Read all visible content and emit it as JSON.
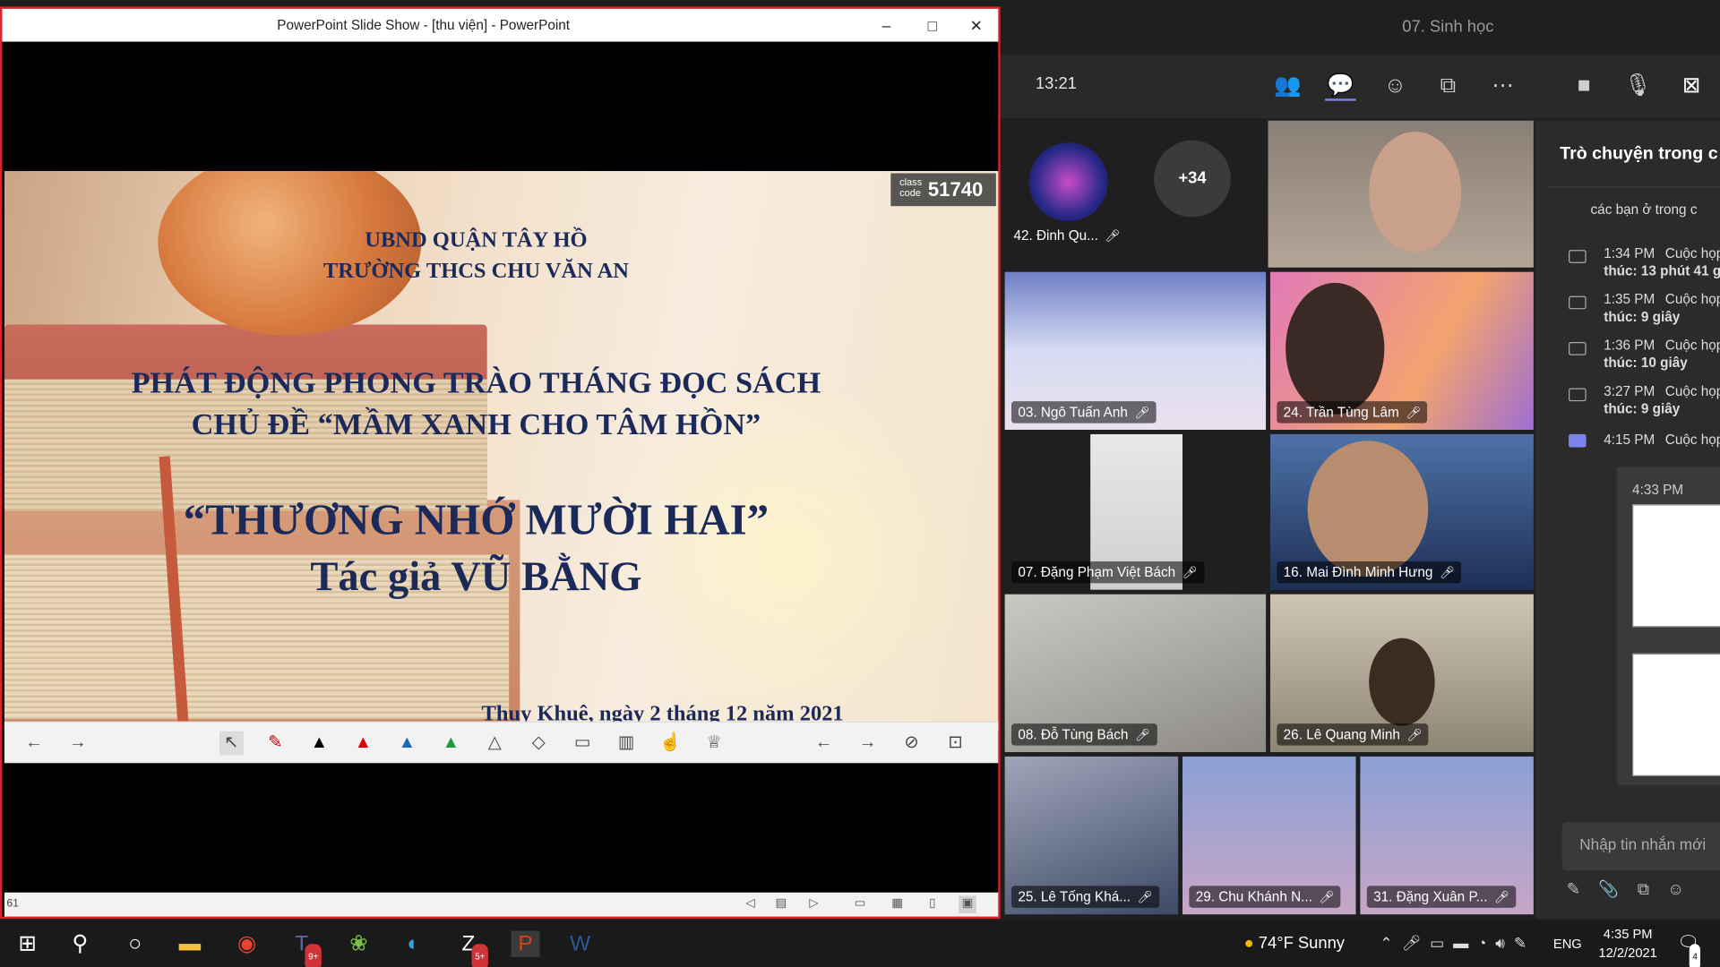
{
  "ppt": {
    "window_title": "PowerPoint Slide Show - [thu viện] - PowerPoint",
    "controls": {
      "minimize": "–",
      "maximize": "□",
      "close": "✕"
    },
    "class_code_label": "class code",
    "class_code": "51740",
    "slide": {
      "line1": "UBND QUẬN TÂY HỒ",
      "line2": "TRƯỜNG THCS CHU VĂN AN",
      "line3": "PHÁT ĐỘNG PHONG TRÀO THÁNG ĐỌC SÁCH",
      "line4": "CHỦ ĐỀ “MẦM XANH CHO TÂM HỒN”",
      "line5": "“THƯƠNG NHỚ MƯỜI HAI”",
      "line6": "Tác giả VŨ BẰNG",
      "line7": "Thụy Khuê, ngày 2 tháng 12 năm 2021"
    },
    "status_slide_number": "61"
  },
  "teams": {
    "meeting_title": "07. Sinh học",
    "time": "13:21",
    "overflow_count": "+34",
    "participants": [
      "42. Đinh Qu...",
      "03. Ngô Tuấn Anh",
      "24. Trần Tùng Lâm",
      "07. Đặng Phạm Việt Bách",
      "16. Mai Đình Minh Hưng",
      "08. Đỗ Tùng Bách",
      "26. Lê Quang Minh",
      "25. Lê Tống Khá...",
      "29. Chu Khánh N...",
      "31. Đặng Xuân P..."
    ],
    "chat": {
      "header": "Trò chuyện trong c",
      "first_line": "các bạn ở trong c",
      "events": [
        {
          "time": "1:34 PM",
          "text": "Cuộc họp",
          "sub": "thúc: 13 phút 41 gi"
        },
        {
          "time": "1:35 PM",
          "text": "Cuộc họp",
          "sub": "thúc: 9 giây"
        },
        {
          "time": "1:36 PM",
          "text": "Cuộc họp",
          "sub": "thúc: 10 giây"
        },
        {
          "time": "3:27 PM",
          "text": "Cuộc họp",
          "sub": "thúc: 9 giây"
        },
        {
          "time": "4:15 PM",
          "text": "Cuộc họp",
          "sub": ""
        }
      ],
      "message_time": "4:33 PM",
      "input_placeholder": "Nhập tin nhắn mới"
    }
  },
  "taskbar": {
    "weather": "74°F  Sunny",
    "language": "ENG",
    "clock_time": "4:35 PM",
    "clock_date": "12/2/2021",
    "notification_count": "4",
    "teams_badge": "9+",
    "zalo_badge": "5+"
  },
  "colors": {
    "ppt_border": "#d9252a",
    "slide_text": "#1c2a5a",
    "teams_bg": "#1f1f1f",
    "taskbar": "#1a1a1a"
  }
}
